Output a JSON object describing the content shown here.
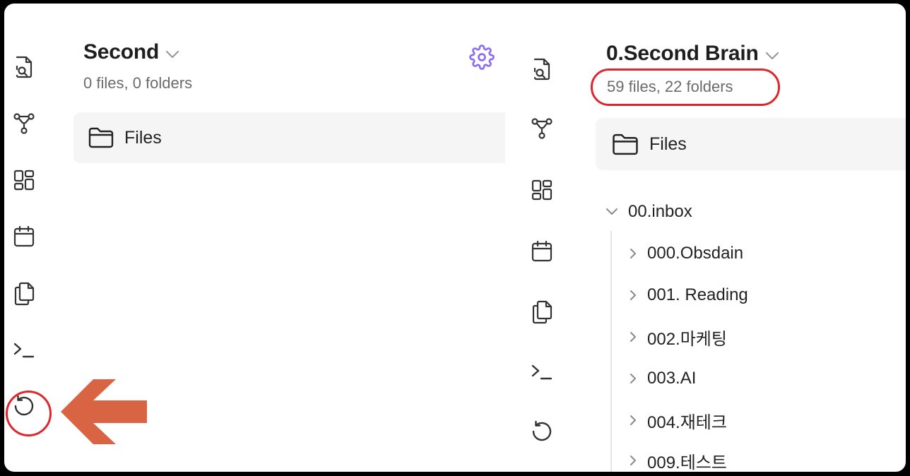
{
  "left_pane": {
    "vault_name": "Second",
    "count_text": "0 files, 0 folders",
    "files_tab_label": "Files"
  },
  "right_pane": {
    "vault_name": "0.Second Brain",
    "count_text": "59 files, 22 folders",
    "files_tab_label": "Files",
    "tree": {
      "root": {
        "label": "00.inbox",
        "expanded": true
      },
      "children": [
        {
          "label": "000.Obsdain"
        },
        {
          "label": "001. Reading"
        },
        {
          "label": "002.마케팅"
        },
        {
          "label": "003.AI"
        },
        {
          "label": "004.재테크"
        },
        {
          "label": "009.테스트"
        }
      ]
    }
  },
  "ribbon_icons": [
    "search-file-icon",
    "graph-icon",
    "dashboard-icon",
    "calendar-icon",
    "copy-icon",
    "terminal-icon",
    "history-icon"
  ],
  "colors": {
    "accent_purple": "#8b6cf6",
    "highlight_red": "#e0262c",
    "arrow_orange": "#d96444"
  }
}
